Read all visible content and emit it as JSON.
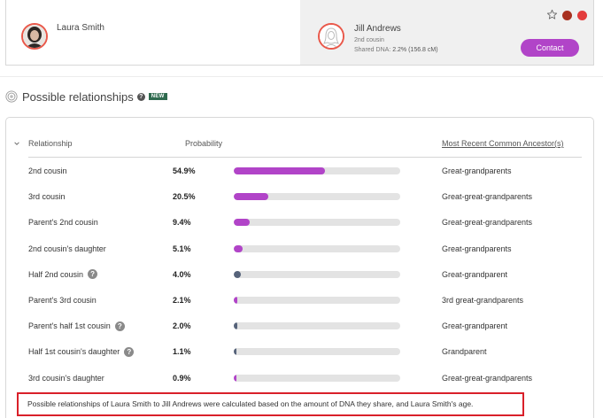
{
  "match_card": {
    "left_person": {
      "name": "Laura Smith"
    },
    "right_person": {
      "name": "Jill Andrews",
      "relationship": "2nd cousin",
      "shared_dna_label": "Shared DNA:",
      "shared_dna_value": "2.2% (156.8 cM)"
    },
    "contact_label": "Contact",
    "status_dots": [
      "#a8301f",
      "#e33b3b"
    ]
  },
  "section": {
    "title": "Possible relationships",
    "badge": "NEW"
  },
  "table": {
    "headers": {
      "relationship": "Relationship",
      "probability": "Probability",
      "ancestor": "Most Recent Common Ancestor(s)"
    },
    "rows": [
      {
        "relationship": "2nd cousin",
        "probability": "54.9%",
        "fraction": 0.549,
        "ancestor": "Great-grandparents",
        "help": false,
        "bar_color": "#b144c8"
      },
      {
        "relationship": "3rd cousin",
        "probability": "20.5%",
        "fraction": 0.205,
        "ancestor": "Great-great-grandparents",
        "help": false,
        "bar_color": "#b144c8"
      },
      {
        "relationship": "Parent's 2nd cousin",
        "probability": "9.4%",
        "fraction": 0.094,
        "ancestor": "Great-great-grandparents",
        "help": false,
        "bar_color": "#b144c8"
      },
      {
        "relationship": "2nd cousin's daughter",
        "probability": "5.1%",
        "fraction": 0.051,
        "ancestor": "Great-grandparents",
        "help": false,
        "bar_color": "#b144c8"
      },
      {
        "relationship": "Half 2nd cousin",
        "probability": "4.0%",
        "fraction": 0.04,
        "ancestor": "Great-grandparent",
        "help": true,
        "bar_color": "#56637a"
      },
      {
        "relationship": "Parent's 3rd cousin",
        "probability": "2.1%",
        "fraction": 0.021,
        "ancestor": "3rd great-grandparents",
        "help": false,
        "bar_color": "#b144c8"
      },
      {
        "relationship": "Parent's half 1st cousin",
        "probability": "2.0%",
        "fraction": 0.02,
        "ancestor": "Great-grandparent",
        "help": true,
        "bar_color": "#56637a"
      },
      {
        "relationship": "Half 1st cousin's daughter",
        "probability": "1.1%",
        "fraction": 0.011,
        "ancestor": "Grandparent",
        "help": true,
        "bar_color": "#56637a"
      },
      {
        "relationship": "3rd cousin's daughter",
        "probability": "0.9%",
        "fraction": 0.009,
        "ancestor": "Great-great-grandparents",
        "help": false,
        "bar_color": "#b144c8"
      }
    ]
  },
  "footnote": "Possible relationships of Laura Smith to Jill Andrews were calculated based on the amount of DNA they share, and Laura Smith's age."
}
